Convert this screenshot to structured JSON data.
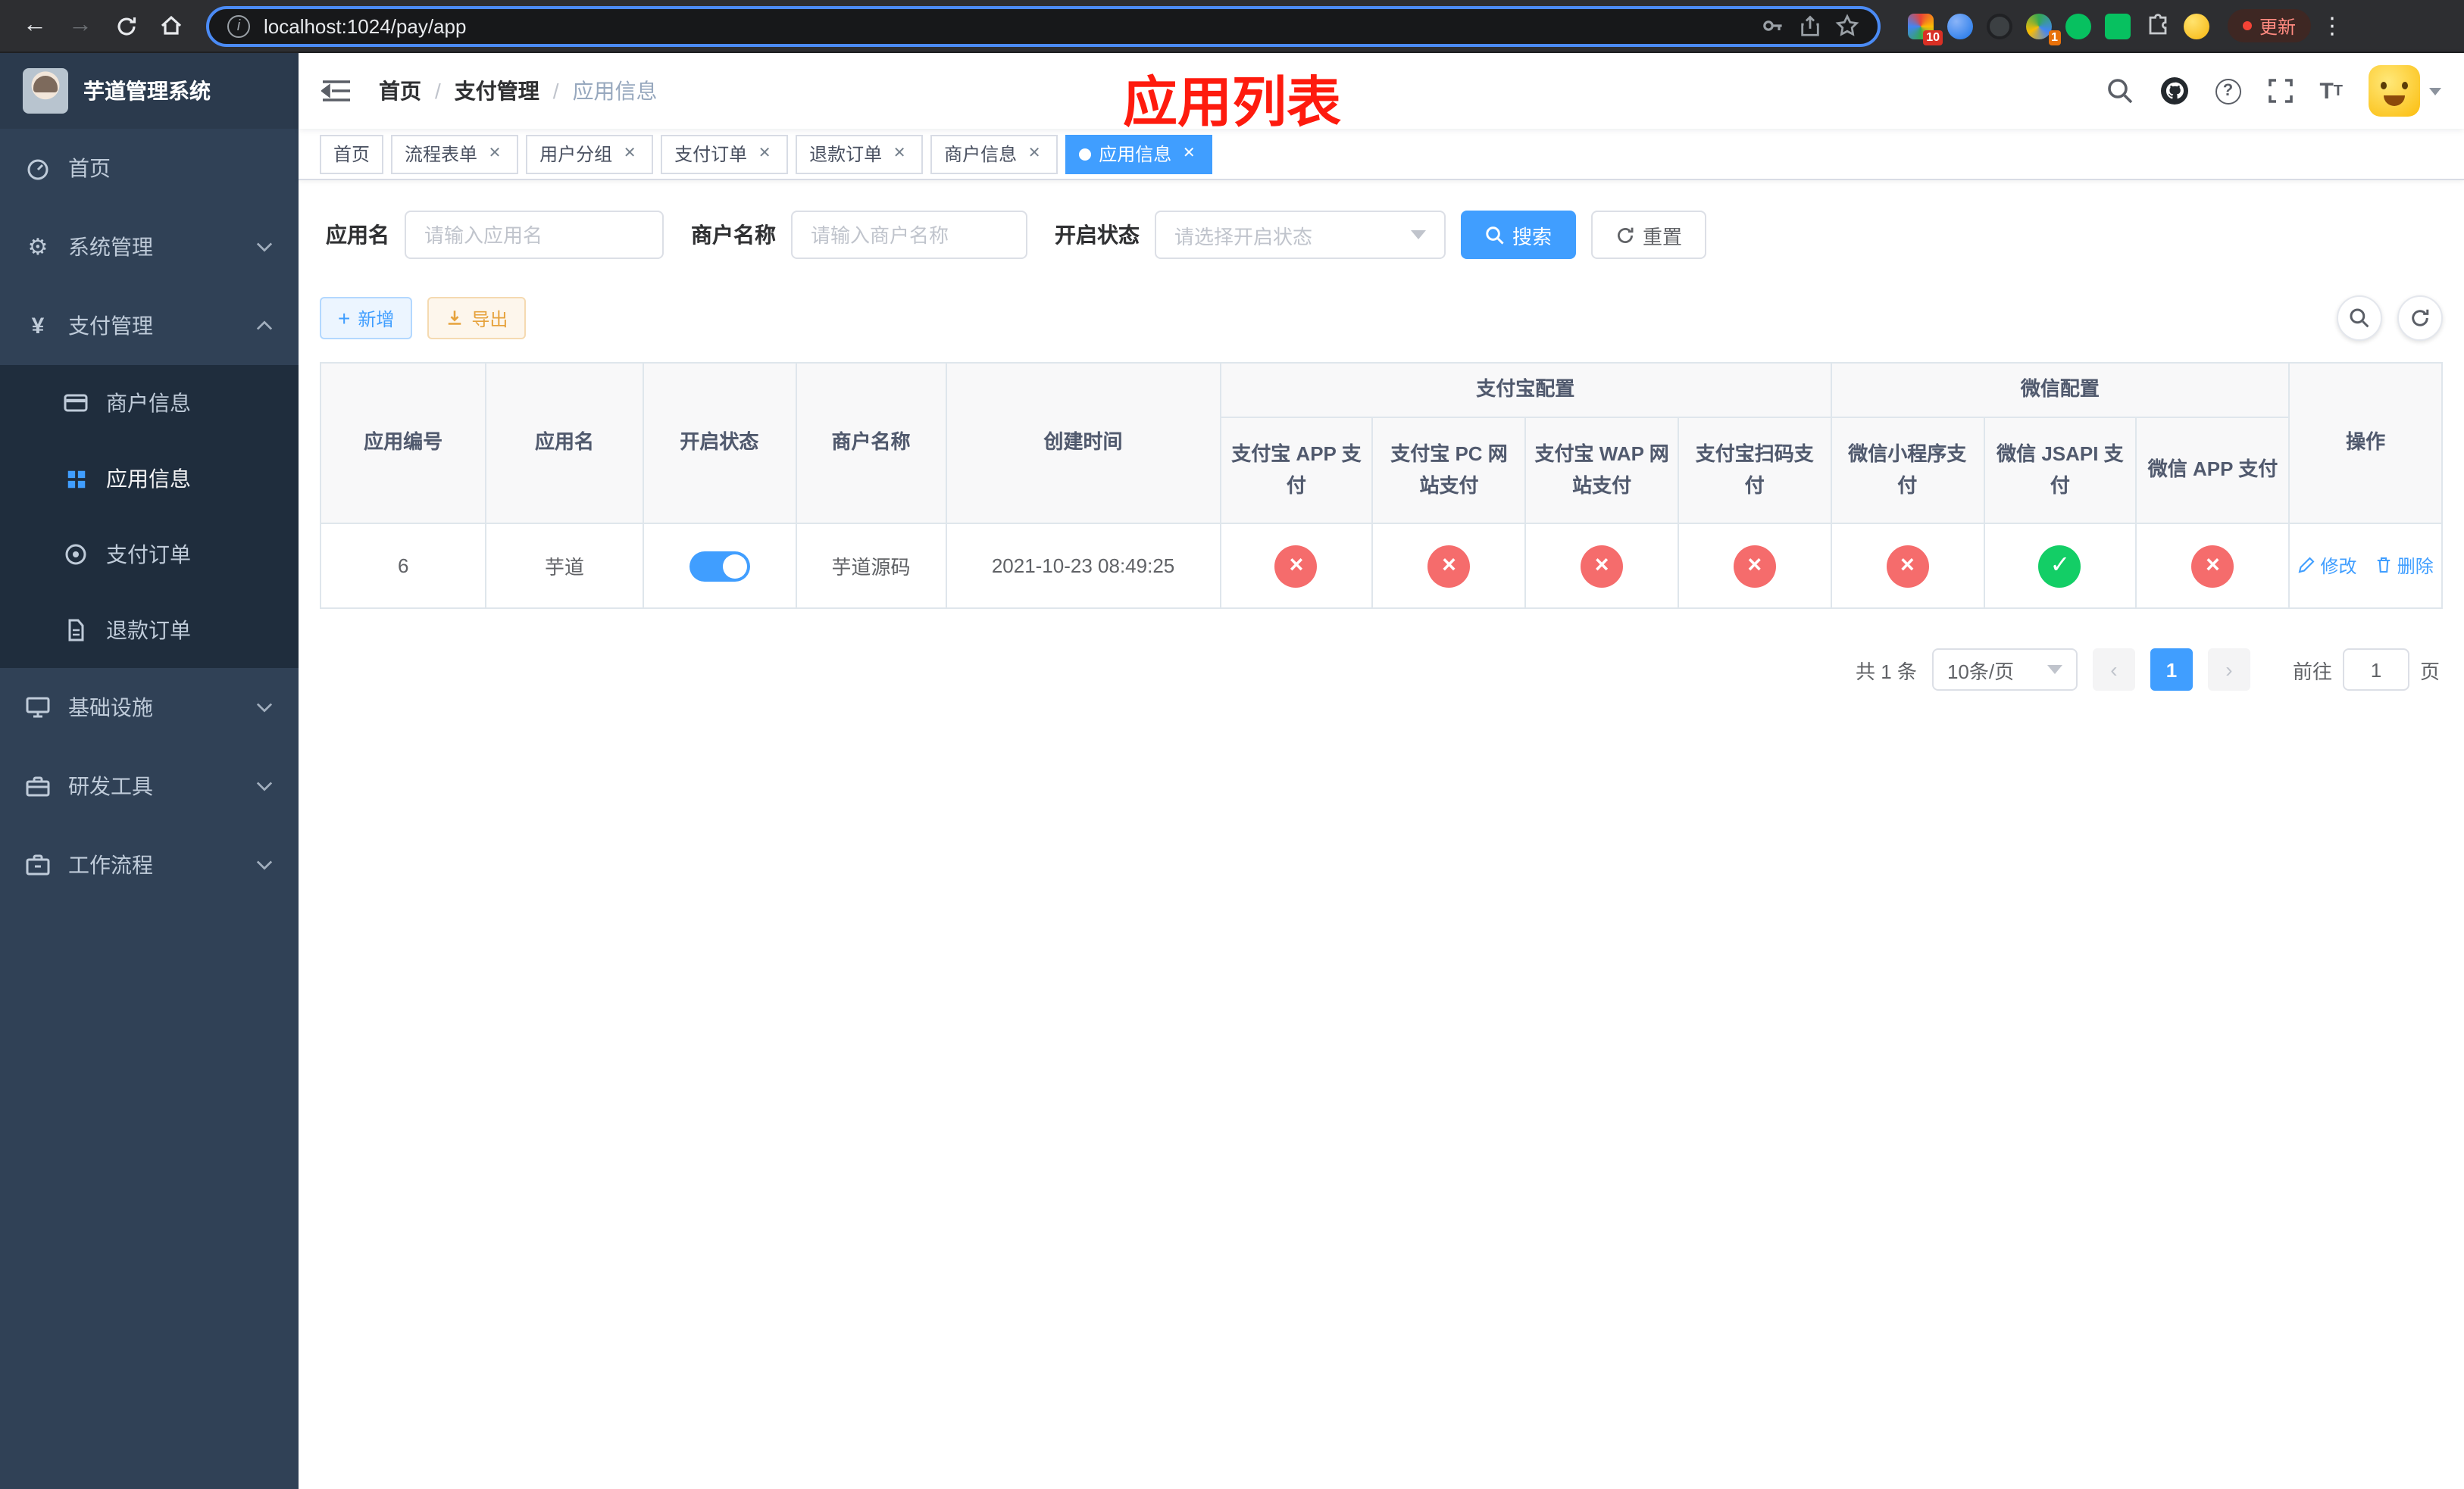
{
  "browser": {
    "url": "localhost:1024/pay/app",
    "update_label": "更新",
    "ext_badges": [
      "10",
      "1"
    ]
  },
  "sidebar": {
    "title": "芋道管理系统",
    "menu": [
      {
        "label": "首页",
        "icon": "dashboard-icon"
      },
      {
        "label": "系统管理",
        "icon": "gear-icon"
      },
      {
        "label": "支付管理",
        "icon": "yen-icon",
        "children": [
          {
            "label": "商户信息",
            "icon": "credit-card-icon"
          },
          {
            "label": "应用信息",
            "icon": "grid-icon",
            "active": true
          },
          {
            "label": "支付订单",
            "icon": "order-icon"
          },
          {
            "label": "退款订单",
            "icon": "document-icon"
          }
        ]
      },
      {
        "label": "基础设施",
        "icon": "monitor-icon"
      },
      {
        "label": "研发工具",
        "icon": "tools-icon"
      },
      {
        "label": "工作流程",
        "icon": "briefcase-icon"
      }
    ]
  },
  "navbar": {
    "breadcrumb": [
      "首页",
      "支付管理",
      "应用信息"
    ],
    "annotation": "应用列表",
    "right_icons": [
      "search-icon",
      "github-icon",
      "help-icon",
      "fullscreen-icon",
      "font-size-icon",
      "avatar"
    ]
  },
  "tabs": [
    {
      "label": "首页",
      "closable": false
    },
    {
      "label": "流程表单",
      "closable": true
    },
    {
      "label": "用户分组",
      "closable": true
    },
    {
      "label": "支付订单",
      "closable": true
    },
    {
      "label": "退款订单",
      "closable": true
    },
    {
      "label": "商户信息",
      "closable": true
    },
    {
      "label": "应用信息",
      "closable": true,
      "active": true
    }
  ],
  "filters": {
    "app_name": {
      "label": "应用名",
      "placeholder": "请输入应用名"
    },
    "merchant_name": {
      "label": "商户名称",
      "placeholder": "请输入商户名称"
    },
    "status": {
      "label": "开启状态",
      "placeholder": "请选择开启状态"
    },
    "search_label": "搜索",
    "reset_label": "重置"
  },
  "toolbar": {
    "add_label": "新增",
    "export_label": "导出"
  },
  "table": {
    "headers": {
      "app_id": "应用编号",
      "app_name": "应用名",
      "status": "开启状态",
      "merchant": "商户名称",
      "created": "创建时间",
      "alipay_group": "支付宝配置",
      "wechat_group": "微信配置",
      "alipay_app": "支付宝 APP 支付",
      "alipay_pc": "支付宝 PC 网站支付",
      "alipay_wap": "支付宝 WAP 网站支付",
      "alipay_qr": "支付宝扫码支付",
      "wx_lite": "微信小程序支付",
      "wx_jsapi": "微信 JSAPI 支付",
      "wx_app": "微信 APP 支付",
      "actions": "操作"
    },
    "rows": [
      {
        "app_id": "6",
        "app_name": "芋道",
        "status": "on",
        "merchant": "芋道源码",
        "created": "2021-10-23 08:49:25",
        "configs": [
          {
            "state": "fail",
            "glyph": "×"
          },
          {
            "state": "fail",
            "glyph": "×"
          },
          {
            "state": "fail",
            "glyph": "×"
          },
          {
            "state": "fail",
            "glyph": "×"
          },
          {
            "state": "fail",
            "glyph": "×"
          },
          {
            "state": "ok",
            "glyph": "✓"
          },
          {
            "state": "fail",
            "glyph": "×"
          }
        ],
        "edit_label": "修改",
        "delete_label": "删除"
      }
    ]
  },
  "pagination": {
    "total": "共 1 条",
    "page_size": "10条/页",
    "page": "1",
    "goto_label": "前往",
    "goto_value": "1",
    "page_unit": "页"
  }
}
